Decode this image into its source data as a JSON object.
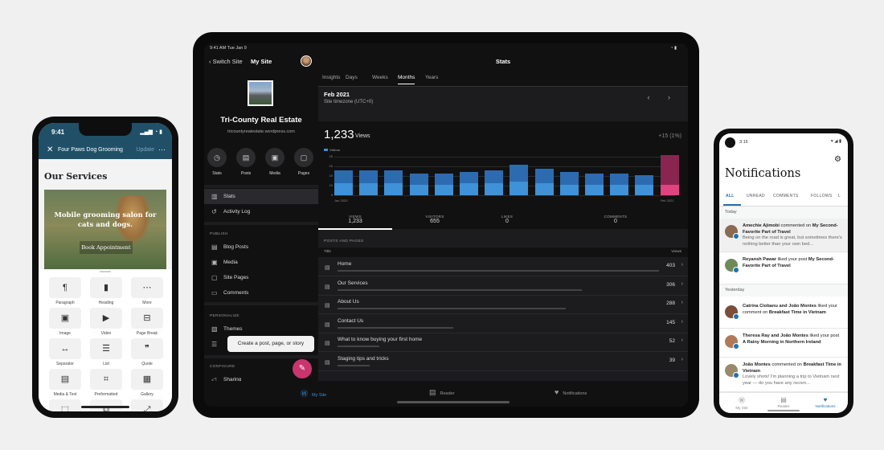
{
  "iphone": {
    "time": "9:41",
    "status": "▂▄▆ ◔ ▮",
    "site_title": "Four Paws Dog Grooming",
    "update_label": "Update",
    "page_heading": "Our Services",
    "hero_text": "Mobile grooming salon for cats and dogs.",
    "hero_button": "Book Appointment",
    "blocks": [
      {
        "icon": "¶",
        "label": "Paragraph"
      },
      {
        "icon": "▮",
        "label": "Heading"
      },
      {
        "icon": "⋯",
        "label": "More"
      },
      {
        "icon": "▣",
        "label": "Image"
      },
      {
        "icon": "▶",
        "label": "Video"
      },
      {
        "icon": "⊟",
        "label": "Page Break"
      },
      {
        "icon": "↔",
        "label": "Separator"
      },
      {
        "icon": "☰",
        "label": "List"
      },
      {
        "icon": "❞",
        "label": "Quote"
      },
      {
        "icon": "▤",
        "label": "Media & Text"
      },
      {
        "icon": "⌗",
        "label": "Preformatted"
      },
      {
        "icon": "▦",
        "label": "Gallery"
      },
      {
        "icon": "⬚",
        "label": ""
      },
      {
        "icon": "⧉",
        "label": ""
      },
      {
        "icon": "⤢",
        "label": ""
      }
    ]
  },
  "ipad": {
    "sidebar": {
      "time": "9:41 AM  Tue Jan 9",
      "back_label": "Switch Site",
      "title": "My Site",
      "site_name": "Tri-County Real Estate",
      "site_url": "tricountyrealestate.wordpress.com",
      "quick_actions": [
        {
          "icon": "◷",
          "label": "Stats"
        },
        {
          "icon": "▤",
          "label": "Posts"
        },
        {
          "icon": "▣",
          "label": "Media"
        },
        {
          "icon": "▢",
          "label": "Pages"
        }
      ],
      "top_items": [
        {
          "icon": "▥",
          "label": "Stats"
        },
        {
          "icon": "↺",
          "label": "Activity Log"
        }
      ],
      "publish_header": "PUBLISH",
      "publish_items": [
        {
          "icon": "▤",
          "label": "Blog Posts"
        },
        {
          "icon": "▣",
          "label": "Media"
        },
        {
          "icon": "▢",
          "label": "Site Pages"
        },
        {
          "icon": "▭",
          "label": "Comments"
        }
      ],
      "personalize_header": "PERSONALIZE",
      "personalize_items": [
        {
          "icon": "▧",
          "label": "Themes"
        },
        {
          "icon": "☰",
          "label": ""
        }
      ],
      "configure_header": "CONFIGURE",
      "configure_items": [
        {
          "icon": "◁",
          "label": "Sharing"
        }
      ],
      "tooltip": "Create a post, page, or story",
      "fab_icon": "✎"
    },
    "main": {
      "status": "◔ ▮",
      "title": "Stats",
      "tabs": [
        "Insights",
        "Days",
        "Weeks",
        "Months",
        "Years"
      ],
      "active_tab": "Months",
      "period": "Feb 2021",
      "timezone": "Site timezone (UTC+0)",
      "nav": "‹ ›",
      "views_total": "1,233",
      "views_unit": "Views",
      "change": "+15 (1%)",
      "legend": "Visitors",
      "summary": [
        {
          "label": "VIEWS",
          "value": "1,233"
        },
        {
          "label": "VISITORS",
          "value": "655"
        },
        {
          "label": "LIKES",
          "value": "0"
        },
        {
          "label": "COMMENTS",
          "value": "0"
        }
      ],
      "posts_header": "POSTS AND PAGES",
      "col_title": "Title",
      "col_views": "Views",
      "posts": [
        {
          "title": "Home",
          "views": "403",
          "share": 1.0
        },
        {
          "title": "Our Services",
          "views": "306",
          "share": 0.76
        },
        {
          "title": "About Us",
          "views": "288",
          "share": 0.71
        },
        {
          "title": "Contact Us",
          "views": "145",
          "share": 0.36
        },
        {
          "title": "What to know buying your first home",
          "views": "52",
          "share": 0.13
        },
        {
          "title": "Staging tips and tricks",
          "views": "39",
          "share": 0.1
        }
      ]
    },
    "tabbar": [
      {
        "icon": "Ⓦ",
        "label": "My Site"
      },
      {
        "icon": "▤",
        "label": "Reader"
      },
      {
        "icon": "♥",
        "label": "Notifications"
      }
    ]
  },
  "chart_data": {
    "type": "bar",
    "categories": [
      "Jan 2020",
      "",
      "",
      "",
      "",
      "",
      "",
      "",
      "",
      "",
      "",
      "",
      "",
      "Feb 2021"
    ],
    "series": [
      {
        "name": "Views",
        "values": [
          16,
          16,
          16,
          14,
          14,
          15,
          16,
          20,
          17,
          15,
          14,
          14,
          13,
          26
        ]
      },
      {
        "name": "Visitors",
        "values": [
          8,
          8,
          8,
          7,
          7,
          8,
          8,
          9,
          8,
          7,
          7,
          7,
          7,
          7
        ]
      }
    ],
    "yticks": [
      "25",
      "20",
      "15",
      "10",
      "5"
    ],
    "ylim": [
      0,
      25
    ],
    "highlight_index": 13
  },
  "android": {
    "time": "3:15",
    "status": "▾ ◢ ▮",
    "title": "Notifications",
    "tabs": [
      "ALL",
      "UNREAD",
      "COMMENTS",
      "FOLLOWS",
      "L"
    ],
    "today": "Today",
    "yesterday": "Yesterday",
    "notifications": [
      {
        "text": "Amechie Ajimobi commented on My Second-Favorite Part of Travel",
        "excerpt": "Being on the road is great, but sometimes there's nothing better than your own bed...",
        "color": "#8a6a52",
        "group": "today"
      },
      {
        "text": "Reyansh Pawar liked your post My Second-Favorite Part of Travel",
        "excerpt": "",
        "color": "#6f8a5a",
        "group": "today"
      },
      {
        "text": "Catrina Ciobanu and João Montes liked your comment on Breakfast Time in Vietnam",
        "excerpt": "",
        "color": "#7a4e3a",
        "group": "yesterday"
      },
      {
        "text": "Theresa Ray and João Montes liked your post A Rainy Morning in Northern Ireland",
        "excerpt": "",
        "color": "#b07a5a",
        "group": "yesterday"
      },
      {
        "text": "João Montes commented on Breakfast Time in Vietnam",
        "excerpt": "Lovely shots! I'm planning a trip to Vietnam next year — do you have any recom...",
        "color": "#9a8a6a",
        "group": "yesterday"
      }
    ],
    "nav": [
      {
        "icon": "Ⓦ",
        "label": "My Site"
      },
      {
        "icon": "▤",
        "label": "Reader"
      },
      {
        "icon": "♥",
        "label": "Notifications"
      }
    ]
  }
}
